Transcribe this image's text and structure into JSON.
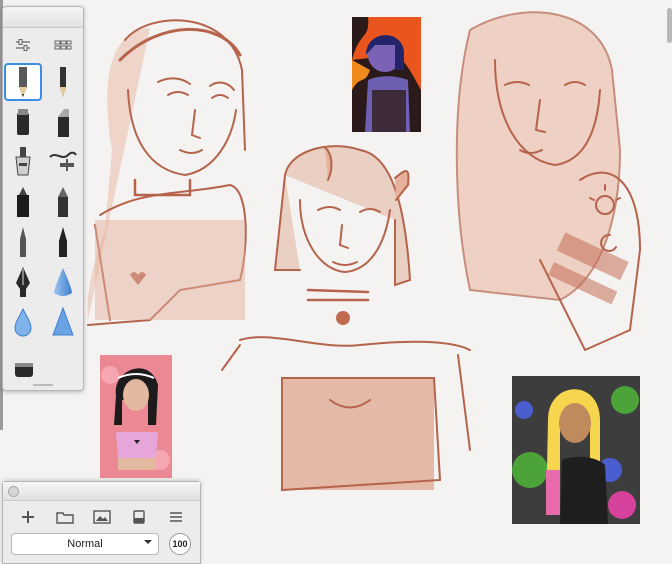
{
  "palette": {
    "header_icons": [
      "sliders-icon",
      "brush-library-icon"
    ],
    "tools": [
      "pencil-tool",
      "fine-pencil-tool",
      "marker-tool",
      "chisel-marker-tool",
      "airbrush-tool",
      "smudge-tool",
      "ink-pen-tool",
      "felt-tip-tool",
      "fine-brush-tool",
      "paint-brush-tool",
      "fountain-pen-tool",
      "soft-cone-tool",
      "droplet-tool",
      "hard-cone-tool",
      "eraser-tool"
    ],
    "selected_tool": "pencil-tool"
  },
  "layer_panel": {
    "actions": [
      "add-layer-icon",
      "folder-icon",
      "image-icon",
      "eraser-layer-icon",
      "menu-icon"
    ],
    "blend_mode": "Normal",
    "opacity": "100"
  },
  "colors": {
    "sketch_stroke": "#b5634b",
    "sketch_fill": "#e8b9a6",
    "selection": "#3b8de6"
  }
}
